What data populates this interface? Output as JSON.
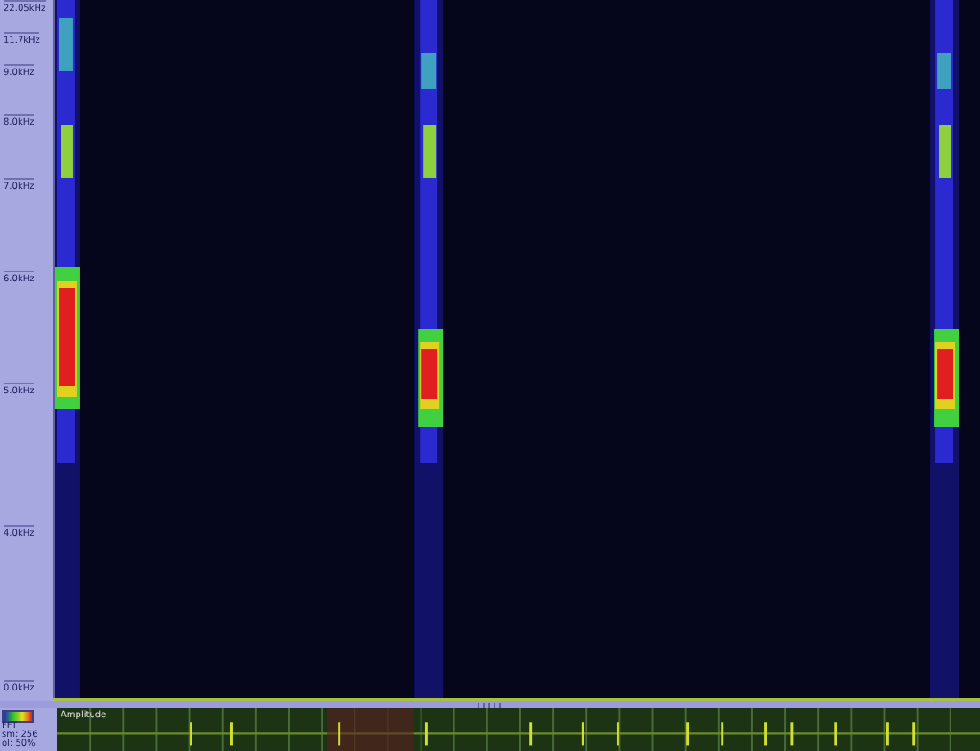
{
  "frequency_axis": {
    "labels": [
      "22.05kHz",
      "11.7kHz",
      "9.0kHz",
      "8.0kHz",
      "7.0kHz",
      "6.0kHz",
      "5.0kHz",
      "4.0kHz",
      "0.0kHz"
    ]
  },
  "legend": {
    "texts": [
      "FFT",
      "sm: 256",
      "ol: 50%"
    ]
  },
  "amplitude_panel": {
    "label": "Amplitude"
  }
}
